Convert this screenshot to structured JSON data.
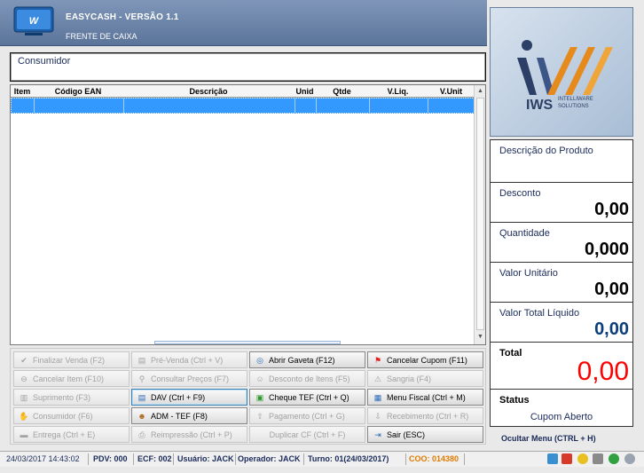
{
  "header": {
    "title": "EASYCASH - VERSÃO 1.1",
    "subtitle": "FRENTE DE CAIXA"
  },
  "consumidor": {
    "label": "Consumidor"
  },
  "grid": {
    "columns": [
      "Item",
      "Código EAN",
      "Descrição",
      "Unid",
      "Qtde",
      "V.Liq.",
      "V.Unit"
    ]
  },
  "buttons": {
    "finalizar": "Finalizar Venda (F2)",
    "pre_venda": "Pré-Venda (Ctrl + V)",
    "abrir_gaveta": "Abrir Gaveta (F12)",
    "cancelar_cupom": "Cancelar Cupom (F11)",
    "cancelar_item": "Cancelar Item (F10)",
    "consultar_precos": "Consultar Preços (F7)",
    "desconto_itens": "Desconto de Itens (F5)",
    "sangria": "Sangria (F4)",
    "suprimento": "Suprimento (F3)",
    "dav": "DAV (Ctrl + F9)",
    "cheque_tef": "Cheque TEF (Ctrl + Q)",
    "menu_fiscal": "Menu Fiscal (Ctrl + M)",
    "consumidor": "Consumidor (F6)",
    "adm_tef": "ADM - TEF (F8)",
    "pagamento": "Pagamento (Ctrl + G)",
    "recebimento": "Recebimento (Ctrl + R)",
    "entrega": "Entrega (Ctrl + E)",
    "reimpressao": "Reimpressão (Ctrl + P)",
    "duplicar_cf": "Duplicar CF (Ctrl + F)",
    "sair": "Sair (ESC)"
  },
  "brand": {
    "name": "IWS",
    "tagline_1": "INTELLIWARE",
    "tagline_2": "SOLUTIONS"
  },
  "panel": {
    "descricao_label": "Descrição do Produto",
    "desconto_label": "Desconto",
    "desconto_value": "0,00",
    "quantidade_label": "Quantidade",
    "quantidade_value": "0,000",
    "valor_unitario_label": "Valor Unitário",
    "valor_unitario_value": "0,00",
    "valor_total_label": "Valor Total Líquido",
    "valor_total_value": "0,00",
    "total_label": "Total",
    "total_value": "0,00",
    "status_label": "Status",
    "status_value": "Cupom Aberto",
    "ocultar_menu": "Ocultar Menu (CTRL + H)"
  },
  "statusbar": {
    "datetime": "24/03/2017 14:43:02",
    "pdv": "PDV: 000",
    "ecf": "ECF: 002",
    "usuario": "Usuário: JACK",
    "operador": "Operador: JACK",
    "turno": "Turno: 01(24/03/2017)",
    "coo": "COO: 014380"
  },
  "colors": {
    "total_red": "#ff0000",
    "valor_total_blue": "#0b3d7a",
    "selection": "#3399ff",
    "coo_orange": "#e07b00"
  }
}
